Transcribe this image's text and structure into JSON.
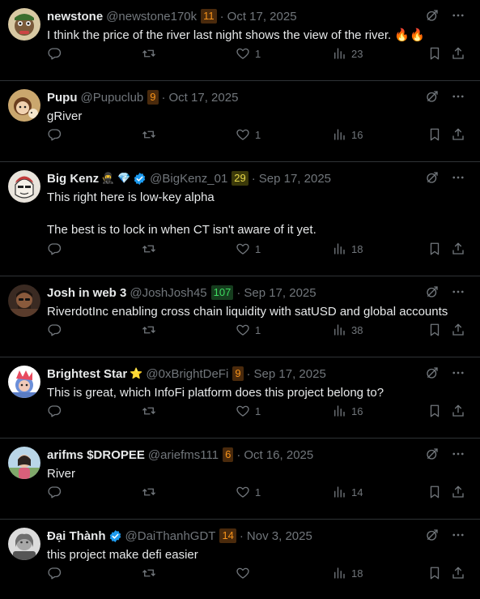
{
  "colors": {
    "background": "#000000",
    "text": "#e7e9ea",
    "muted": "#71767b",
    "divider": "#2f3336",
    "verified": "#1d9bf0"
  },
  "tweets": [
    {
      "name": "newstone",
      "name_extra": "",
      "verified": false,
      "handle": "@newstone170k",
      "score": "11",
      "score_style": "orange",
      "date": "Oct 17, 2025",
      "text": "I think the price of the river last night shows the view of the river. 🔥🔥",
      "replies": "",
      "reposts": "",
      "likes": "1",
      "views": "23",
      "avatar": "avatar-newstone"
    },
    {
      "name": "Pupu",
      "name_extra": "",
      "verified": false,
      "handle": "@Pupuclub",
      "score": "9",
      "score_style": "orange",
      "date": "Oct 17, 2025",
      "text": "gRiver",
      "replies": "",
      "reposts": "",
      "likes": "1",
      "views": "16",
      "avatar": "avatar-pupu"
    },
    {
      "name": "Big Kenz",
      "name_extra": "🥷 💎",
      "verified": true,
      "handle": "@BigKenz_01",
      "score": "29",
      "score_style": "lime",
      "date": "Sep 17, 2025",
      "text": "This right here is low-key alpha\n\nThe best is to lock in when CT isn't aware of it yet.",
      "replies": "",
      "reposts": "",
      "likes": "1",
      "views": "18",
      "avatar": "avatar-bigkenz"
    },
    {
      "name": "Josh in web 3",
      "name_extra": "",
      "verified": false,
      "handle": "@JoshJosh45",
      "score": "107",
      "score_style": "green",
      "date": "Sep 17, 2025",
      "text": "RiverdotInc enabling cross chain liquidity with satUSD and global accounts",
      "replies": "",
      "reposts": "",
      "likes": "1",
      "views": "38",
      "avatar": "avatar-josh"
    },
    {
      "name": "Brightest Star",
      "name_extra": "⭐",
      "verified": false,
      "handle": "@0xBrightDeFi",
      "score": "9",
      "score_style": "orange",
      "date": "Sep 17, 2025",
      "text": "This is great, which InfoFi platform does this project belong to?",
      "replies": "",
      "reposts": "",
      "likes": "1",
      "views": "16",
      "avatar": "avatar-brightest"
    },
    {
      "name": "arifms $DROPEE",
      "name_extra": "",
      "verified": false,
      "handle": "@ariefms111",
      "score": "6",
      "score_style": "orange",
      "date": "Oct 16, 2025",
      "text": "River",
      "replies": "",
      "reposts": "",
      "likes": "1",
      "views": "14",
      "avatar": "avatar-arifms"
    },
    {
      "name": "Đại Thành",
      "name_extra": "",
      "verified": true,
      "handle": "@DaiThanhGDT",
      "score": "14",
      "score_style": "orange",
      "date": "Nov 3, 2025",
      "text": "this project make defi easier",
      "replies": "",
      "reposts": "",
      "likes": "",
      "views": "18",
      "avatar": "avatar-daithanh"
    }
  ]
}
